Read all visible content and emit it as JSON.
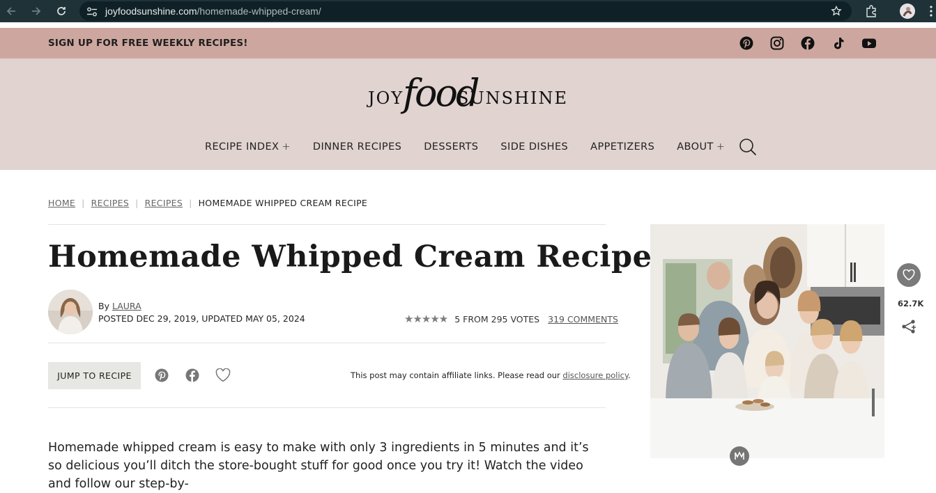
{
  "browser": {
    "url_domain": "joyfoodsunshine.com",
    "url_path": "/homemade-whipped-cream/"
  },
  "topbar": {
    "signup_text": "SIGN UP FOR FREE WEEKLY RECIPES!",
    "socials": [
      "pinterest-icon",
      "instagram-icon",
      "facebook-icon",
      "tiktok-icon",
      "youtube-icon"
    ]
  },
  "logo": {
    "joy": "JOY",
    "food": "food",
    "sunshine": "SUNSHINE"
  },
  "nav": {
    "items": [
      {
        "label": "RECIPE INDEX",
        "has_plus": true
      },
      {
        "label": "DINNER RECIPES",
        "has_plus": false
      },
      {
        "label": "DESSERTS",
        "has_plus": false
      },
      {
        "label": "SIDE DISHES",
        "has_plus": false
      },
      {
        "label": "APPETIZERS",
        "has_plus": false
      },
      {
        "label": "ABOUT",
        "has_plus": true
      }
    ],
    "plus_symbol": "+"
  },
  "breadcrumb": {
    "items": [
      "HOME",
      "RECIPES",
      "RECIPES"
    ],
    "current": "HOMEMADE WHIPPED CREAM RECIPE",
    "separator": "|"
  },
  "post": {
    "title": "Homemade Whipped Cream Recipe",
    "by_prefix": "By",
    "author": "LAURA",
    "posted": "POSTED DEC 29, 2019, UPDATED MAY 05, 2024",
    "stars": "★★★★★",
    "rating_value": 5,
    "votes_text": "5 FROM 295 VOTES",
    "comments_link": "319 COMMENTS",
    "jump_label": "JUMP TO RECIPE",
    "affiliate_text": "This post may contain affiliate links. Please read our",
    "affiliate_link": "disclosure policy",
    "affiliate_end": ".",
    "intro": "Homemade whipped cream is easy to make with only 3 ingredients in 5 minutes and it’s so delicious you’ll ditch the store-bought stuff for good once you try it! Watch the video and follow our step-by-"
  },
  "floating_share": {
    "count": "62.7K"
  },
  "colors": {
    "topbar": "#cda79f",
    "header": "#e0d3d0",
    "chrome": "#1f3237"
  }
}
